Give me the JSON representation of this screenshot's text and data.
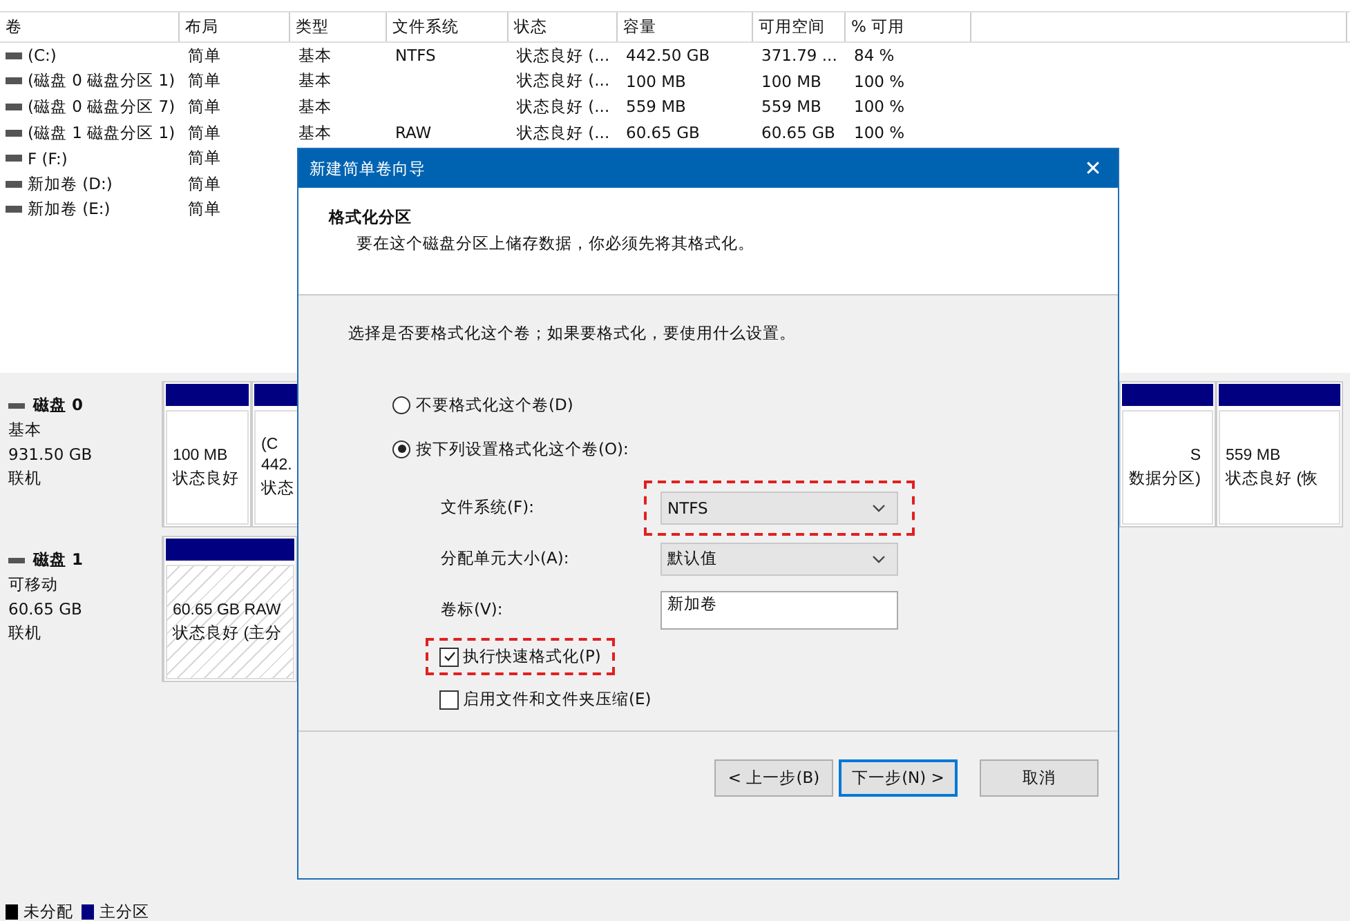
{
  "volume_list": {
    "columns": [
      "卷",
      "布局",
      "类型",
      "文件系统",
      "状态",
      "容量",
      "可用空间",
      "% 可用"
    ],
    "rows": [
      {
        "cells": [
          "(C:)",
          "简单",
          "基本",
          "NTFS",
          "状态良好 (...",
          "442.50 GB",
          "371.79 ...",
          "84 %"
        ]
      },
      {
        "cells": [
          "(磁盘 0 磁盘分区 1)",
          "简单",
          "基本",
          "",
          "状态良好 (...",
          "100 MB",
          "100 MB",
          "100 %"
        ]
      },
      {
        "cells": [
          "(磁盘 0 磁盘分区 7)",
          "简单",
          "基本",
          "",
          "状态良好 (...",
          "559 MB",
          "559 MB",
          "100 %"
        ]
      },
      {
        "cells": [
          "(磁盘 1 磁盘分区 1)",
          "简单",
          "基本",
          "RAW",
          "状态良好 (...",
          "60.65 GB",
          "60.65 GB",
          "100 %"
        ]
      },
      {
        "cells": [
          "F (F:)",
          "简单"
        ]
      },
      {
        "cells": [
          "新加卷 (D:)",
          "简单"
        ]
      },
      {
        "cells": [
          "新加卷 (E:)",
          "简单"
        ]
      }
    ]
  },
  "disks": [
    {
      "name": "磁盘 0",
      "type": "基本",
      "size": "931.50 GB",
      "status": "联机",
      "partitions": [
        {
          "kind": "primary",
          "lines": [
            "100 MB",
            "状态良好"
          ]
        },
        {
          "kind": "primary",
          "lines": [
            "(C",
            "442.",
            "状态"
          ]
        },
        {
          "kind": "primary",
          "lines": [
            "S",
            "数据分区)"
          ]
        },
        {
          "kind": "primary",
          "lines": [
            "559 MB",
            "状态良好 (恢"
          ]
        }
      ]
    },
    {
      "name": "磁盘 1",
      "type": "可移动",
      "size": "60.65 GB",
      "status": "联机",
      "partitions": [
        {
          "kind": "raw",
          "lines": [
            "60.65 GB RAW",
            "状态良好 (主分"
          ]
        }
      ]
    }
  ],
  "legend": [
    {
      "label": "未分配",
      "color": "#000000"
    },
    {
      "label": "主分区",
      "color": "#000080"
    }
  ],
  "dialog": {
    "title": "新建简单卷向导",
    "close": "✕",
    "heading": "格式化分区",
    "subheading": "要在这个磁盘分区上储存数据，你必须先将其格式化。",
    "prompt": "选择是否要格式化这个卷；如果要格式化，要使用什么设置。",
    "options": [
      {
        "label": "不要格式化这个卷(D)",
        "selected": false
      },
      {
        "label": "按下列设置格式化这个卷(O):",
        "selected": true
      }
    ],
    "fields": [
      {
        "kind": "select",
        "label": "文件系统(F):",
        "value": "NTFS",
        "highlighted": true
      },
      {
        "kind": "select",
        "label": "分配单元大小(A):",
        "value": "默认值",
        "highlighted": false
      },
      {
        "kind": "text",
        "label": "卷标(V):",
        "value": "新加卷",
        "highlighted": false
      }
    ],
    "checkboxes": [
      {
        "label": "执行快速格式化(P)",
        "checked": true,
        "highlighted": true
      },
      {
        "label": "启用文件和文件夹压缩(E)",
        "checked": false,
        "highlighted": false
      }
    ],
    "buttons": [
      {
        "label": "< 上一步(B)",
        "focused": false
      },
      {
        "label": "下一步(N) >",
        "focused": true
      },
      {
        "label": "取消",
        "focused": false
      }
    ]
  }
}
